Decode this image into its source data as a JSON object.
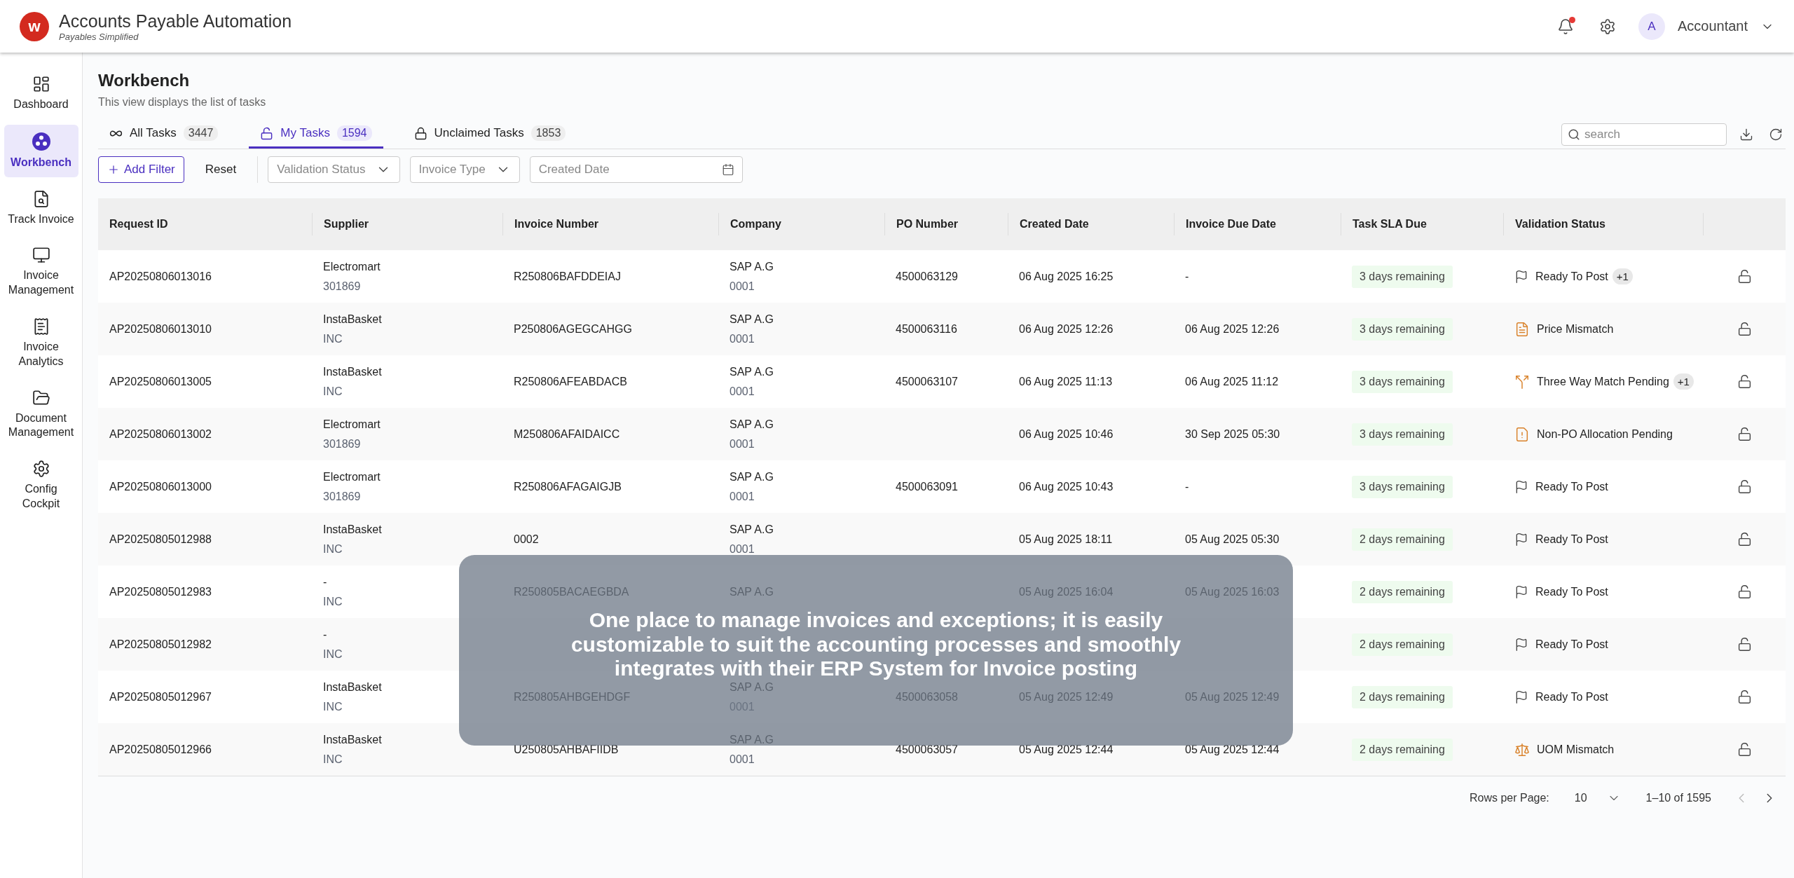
{
  "header": {
    "logo_letter": "w",
    "title": "Accounts Payable Automation",
    "subtitle": "Payables Simplified",
    "has_notification": true,
    "avatar": "A",
    "user": "Accountant"
  },
  "sidebar": {
    "items": [
      {
        "label": "Dashboard",
        "kind": "dashboard",
        "selected": false
      },
      {
        "label": "Workbench",
        "kind": "workbench",
        "selected": true
      },
      {
        "label": "Track Invoice",
        "kind": "track",
        "selected": false
      },
      {
        "label": "Invoice Management",
        "kind": "management",
        "selected": false
      },
      {
        "label": "Invoice Analytics",
        "kind": "analytics",
        "selected": false
      },
      {
        "label": "Document Management",
        "kind": "documents",
        "selected": false
      },
      {
        "label": "Config Cockpit",
        "kind": "config",
        "selected": false
      }
    ]
  },
  "page": {
    "title": "Workbench",
    "subtitle": "This view displays the list of tasks"
  },
  "tabs": [
    {
      "label": "All Tasks",
      "count": "3447",
      "kind": "all",
      "selected": false
    },
    {
      "label": "My Tasks",
      "count": "1594",
      "kind": "mine",
      "selected": true
    },
    {
      "label": "Unclaimed Tasks",
      "count": "1853",
      "kind": "unclaimed",
      "selected": false
    }
  ],
  "search": {
    "placeholder": "search"
  },
  "filters": {
    "add_button": "Add Filter",
    "reset_button": "Reset",
    "dropdowns": [
      {
        "placeholder": "Validation Status"
      },
      {
        "placeholder": "Invoice Type"
      }
    ],
    "date_field": {
      "placeholder": "Created Date"
    }
  },
  "table": {
    "columns": [
      "Request ID",
      "Supplier",
      "Invoice Number",
      "Company",
      "PO Number",
      "Created Date",
      "Invoice Due Date",
      "Task SLA Due",
      "Validation Status"
    ],
    "rows": [
      {
        "request_id": "AP20250806013016",
        "supplier": "Electromart",
        "supplier_code": "301869",
        "invoice_number": "R250806BAFDDEIAJ",
        "company": "SAP A.G",
        "company_code": "0001",
        "po_number": "4500063129",
        "created": "06 Aug 2025 16:25",
        "due": "-",
        "sla": "3 days remaining",
        "status": {
          "kind": "flag",
          "label": "Ready To Post",
          "extra": "+1"
        }
      },
      {
        "request_id": "AP20250806013010",
        "supplier": "InstaBasket",
        "supplier_code": "INC",
        "invoice_number": "P250806AGEGCAHGG",
        "company": "SAP A.G",
        "company_code": "0001",
        "po_number": "4500063116",
        "created": "06 Aug 2025 12:26",
        "due": "06 Aug 2025 12:26",
        "sla": "3 days remaining",
        "status": {
          "kind": "price",
          "label": "Price Mismatch"
        }
      },
      {
        "request_id": "AP20250806013005",
        "supplier": "InstaBasket",
        "supplier_code": "INC",
        "invoice_number": "R250806AFEABDACB",
        "company": "SAP A.G",
        "company_code": "0001",
        "po_number": "4500063107",
        "created": "06 Aug 2025 11:13",
        "due": "06 Aug 2025 11:12",
        "sla": "3 days remaining",
        "status": {
          "kind": "match",
          "label": "Three Way Match Pending",
          "extra": "+1"
        }
      },
      {
        "request_id": "AP20250806013002",
        "supplier": "Electromart",
        "supplier_code": "301869",
        "invoice_number": "M250806AFAIDAICC",
        "company": "SAP A.G",
        "company_code": "0001",
        "created": "06 Aug 2025 10:46",
        "due": "30 Sep 2025 05:30",
        "sla": "3 days remaining",
        "status": {
          "kind": "allocation",
          "label": "Non-PO Allocation Pending"
        }
      },
      {
        "request_id": "AP20250806013000",
        "supplier": "Electromart",
        "supplier_code": "301869",
        "invoice_number": "R250806AFAGAIGJB",
        "company": "SAP A.G",
        "company_code": "0001",
        "po_number": "4500063091",
        "created": "06 Aug 2025 10:43",
        "due": "-",
        "sla": "3 days remaining",
        "status": {
          "kind": "flag",
          "label": "Ready To Post"
        }
      },
      {
        "request_id": "AP20250805012988",
        "supplier": "InstaBasket",
        "supplier_code": "INC",
        "invoice_number": "0002",
        "company": "SAP A.G",
        "company_code": "0001",
        "created": "05 Aug 2025 18:11",
        "due": "05 Aug 2025 05:30",
        "sla": "2 days remaining",
        "status": {
          "kind": "flag",
          "label": "Ready To Post"
        }
      },
      {
        "request_id": "AP20250805012983",
        "supplier": "-",
        "supplier_code": "INC",
        "invoice_number": "R250805BACAEGBDA",
        "company": "SAP A.G",
        "created": "05 Aug 2025 16:04",
        "due": "05 Aug 2025 16:03",
        "sla": "2 days remaining",
        "status": {
          "kind": "flag",
          "label": "Ready To Post"
        }
      },
      {
        "request_id": "AP20250805012982",
        "supplier": "-",
        "supplier_code": "INC",
        "sla": "2 days remaining",
        "status": {
          "kind": "flag",
          "label": "Ready To Post"
        }
      },
      {
        "request_id": "AP20250805012967",
        "supplier": "InstaBasket",
        "supplier_code": "INC",
        "invoice_number": "R250805AHBGEHDGF",
        "company": "SAP A.G",
        "company_code": "0001",
        "po_number": "4500063058",
        "created": "05 Aug 2025 12:49",
        "due": "05 Aug 2025 12:49",
        "sla": "2 days remaining",
        "status": {
          "kind": "flag",
          "label": "Ready To Post"
        }
      },
      {
        "request_id": "AP20250805012966",
        "supplier": "InstaBasket",
        "supplier_code": "INC",
        "invoice_number": "U250805AHBAFIIDB",
        "company": "SAP A.G",
        "company_code": "0001",
        "po_number": "4500063057",
        "created": "05 Aug 2025 12:44",
        "due": "05 Aug 2025 12:44",
        "sla": "2 days remaining",
        "status": {
          "kind": "scale",
          "label": "UOM Mismatch"
        }
      }
    ]
  },
  "pagination": {
    "rows_label": "Rows per Page:",
    "rows_value": "10",
    "range": "1–10 of 1595",
    "prev_disabled": true,
    "next_disabled": false
  },
  "caption": {
    "lines": [
      "One place to manage invoices and exceptions; it is easily",
      "customizable to suit the accounting processes and smoothly",
      "integrates with their ERP System for Invoice posting"
    ]
  }
}
